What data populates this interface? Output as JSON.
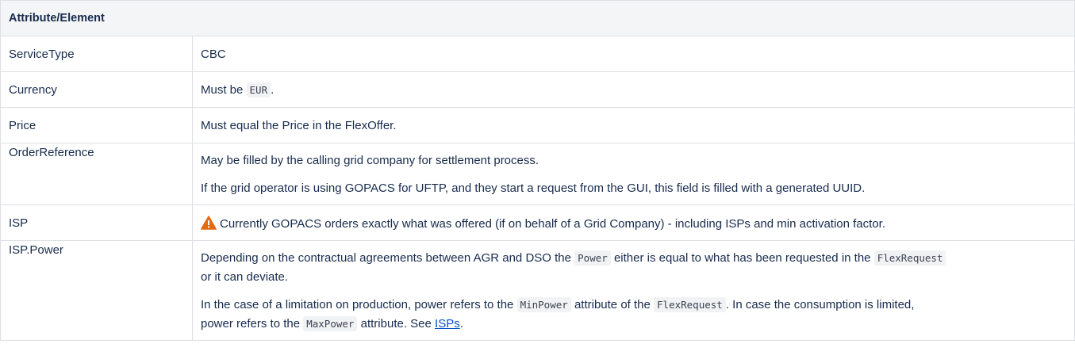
{
  "table": {
    "header": [
      "Attribute/Element"
    ],
    "rows": {
      "service_type": {
        "key": "ServiceType",
        "value": "CBC"
      },
      "currency": {
        "key": "Currency",
        "pre": "Must be",
        "code": "EUR",
        "post": "."
      },
      "price": {
        "key": "Price",
        "value": "Must equal the Price in the FlexOffer."
      },
      "order_reference": {
        "key": "OrderReference",
        "p1": "May be filled by the calling grid company for settlement process.",
        "p2": "If the grid operator is using GOPACS for UFTP, and they start a request from the GUI, this field is filled with a generated UUID."
      },
      "isp": {
        "key": "ISP",
        "icon": "warning-icon",
        "icon_color": "#e56910",
        "value": "Currently GOPACS orders exactly what was offered (if on behalf of a Grid Company) - including ISPs and min activation factor."
      },
      "isp_power": {
        "key": "ISP.Power",
        "p1_a": "Depending on the contractual agreements between AGR and DSO the",
        "p1_code1": "Power",
        "p1_b": "either is equal to what has been requested in the",
        "p1_code2": "FlexRequest",
        "p1_c": "or it can deviate.",
        "p2_a": "In the case of a limitation on production, power refers to the",
        "p2_code1": "MinPower",
        "p2_b": "attribute of the",
        "p2_code2": "FlexRequest",
        "p2_c": ". In case the consumption is limited,",
        "p2_d": "power refers to the",
        "p2_code3": "MaxPower",
        "p2_e": "attribute. See",
        "p2_link": "ISPs",
        "p2_f": "."
      }
    }
  }
}
